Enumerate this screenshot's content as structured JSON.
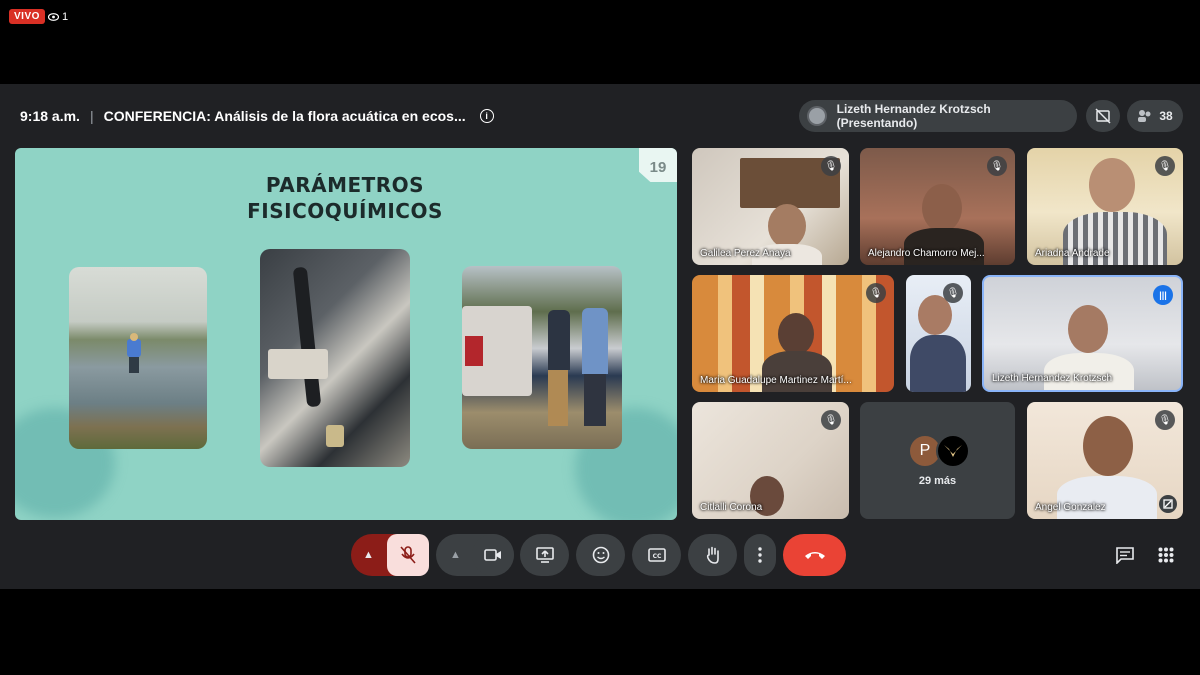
{
  "stream": {
    "live_label": "VIVO",
    "viewer_count": "1"
  },
  "header": {
    "time": "9:18 a.m.",
    "separator": "|",
    "meeting_title": "CONFERENCIA: Análisis de la flora acuática en ecos...",
    "presenter_label": "Lizeth Hernandez Krotzsch (Presentando)",
    "participant_count": "38"
  },
  "slide": {
    "number": "19",
    "title_line1": "PARÁMETROS",
    "title_line2": "FISICOQUÍMICOS"
  },
  "participants": [
    {
      "name": "Galilea Perez Anaya",
      "muted": true
    },
    {
      "name": "Alejandro Chamorro Mej...",
      "muted": true
    },
    {
      "name": "Ariadna Andrade",
      "muted": true
    },
    {
      "name": "Maria Guadalupe Martinez Martí...",
      "muted": true
    },
    {
      "name": "",
      "muted": true
    },
    {
      "name": "Lizeth Hernandez Krotzsch",
      "muted": false,
      "speaking": true
    },
    {
      "name": "Citlalli Corona",
      "muted": true
    },
    {
      "name": "Angel Gonzalez",
      "muted": true
    }
  ],
  "more_tile": {
    "avatar_letter": "P",
    "label": "29 más"
  },
  "controls": {
    "mic_state": "muted",
    "camera_state": "off",
    "end_call_color": "#ea4335",
    "mic_bg_color": "#f9dedc"
  },
  "colors": {
    "live": "#d93025",
    "speaking": "#1a73e8",
    "slide_bg": "#8fd3c5"
  }
}
